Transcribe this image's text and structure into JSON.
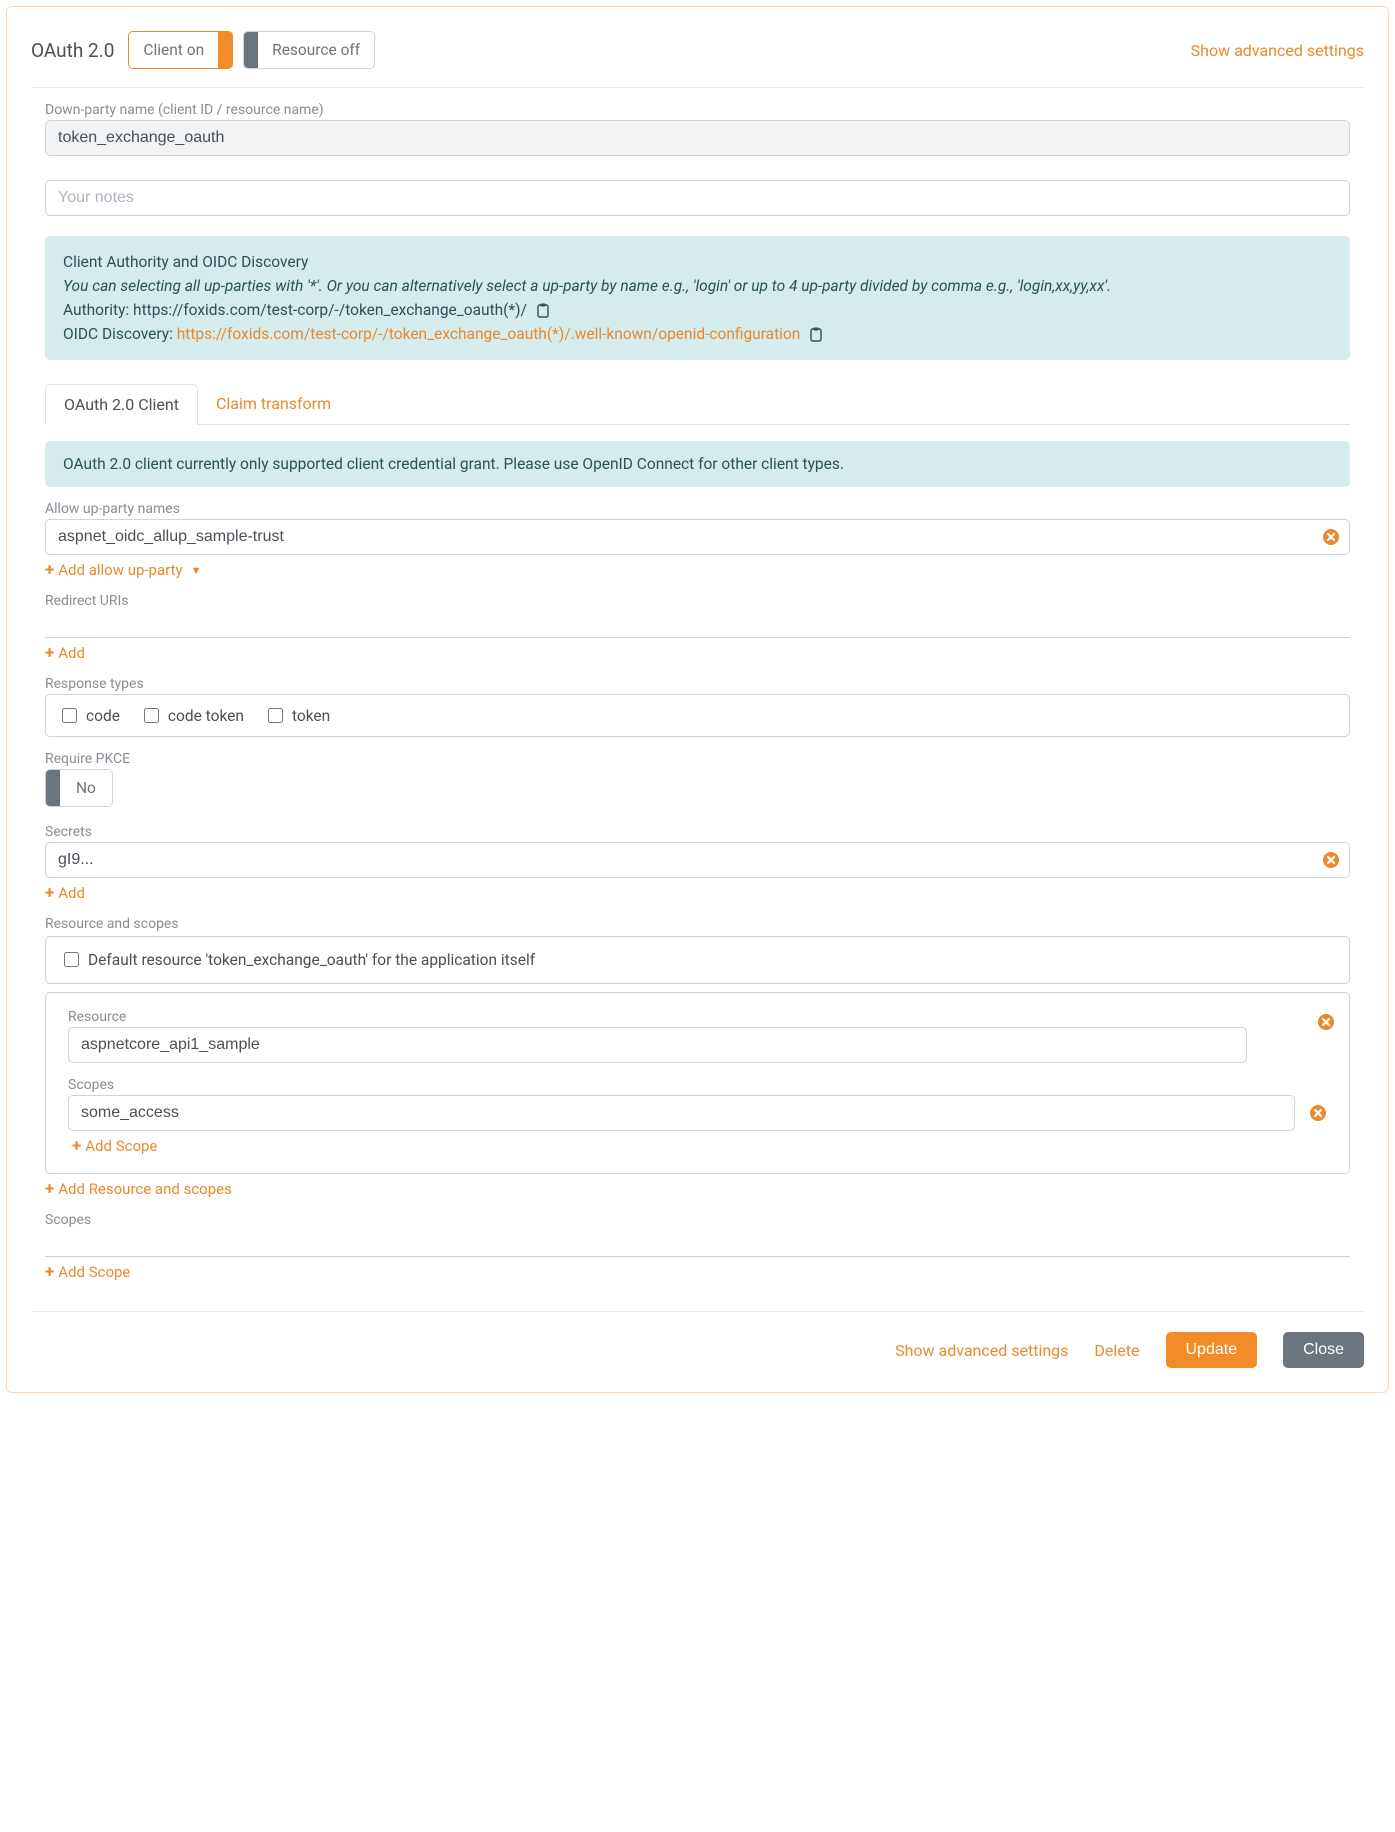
{
  "header": {
    "title": "OAuth 2.0",
    "client_toggle": "Client on",
    "resource_toggle": "Resource off",
    "advanced_link": "Show advanced settings"
  },
  "name_field": {
    "label": "Down-party name (client ID / resource name)",
    "value": "token_exchange_oauth"
  },
  "notes_placeholder": "Your notes",
  "authority_panel": {
    "heading": "Client Authority and OIDC Discovery",
    "desc": "You can selecting all up-parties with '*'. Or you can alternatively select a up-party by name e.g., 'login' or up to 4 up-party divided by comma e.g., 'login,xx,yy,xx'.",
    "authority_label": "Authority: ",
    "authority_value": "https://foxids.com/test-corp/-/token_exchange_oauth(*)/",
    "oidc_label": "OIDC Discovery: ",
    "oidc_link": "https://foxids.com/test-corp/-/token_exchange_oauth(*)/.well-known/openid-configuration"
  },
  "tabs": {
    "client": "OAuth 2.0 Client",
    "claim": "Claim transform"
  },
  "client_notice": "OAuth 2.0 client currently only supported client credential grant. Please use OpenID Connect for other client types.",
  "allow_up": {
    "label": "Allow up-party names",
    "value": "aspnet_oidc_allup_sample-trust",
    "add_label": "Add allow up-party"
  },
  "redirect": {
    "label": "Redirect URIs",
    "add_label": "Add"
  },
  "response_types": {
    "label": "Response types",
    "items": [
      "code",
      "code token",
      "token"
    ]
  },
  "pkce": {
    "label": "Require PKCE",
    "value": "No"
  },
  "secrets": {
    "label": "Secrets",
    "value": "gI9...",
    "add_label": "Add"
  },
  "resource_scopes": {
    "label": "Resource and scopes",
    "default_label": "Default resource 'token_exchange_oauth' for the application itself",
    "resource_label": "Resource",
    "resource_value": "aspnetcore_api1_sample",
    "scopes_label": "Scopes",
    "scope_value": "some_access",
    "add_scope": "Add Scope",
    "add_resource": "Add Resource and scopes"
  },
  "scopes": {
    "label": "Scopes",
    "add_label": "Add Scope"
  },
  "footer": {
    "advanced": "Show advanced settings",
    "delete": "Delete",
    "update": "Update",
    "close": "Close"
  }
}
